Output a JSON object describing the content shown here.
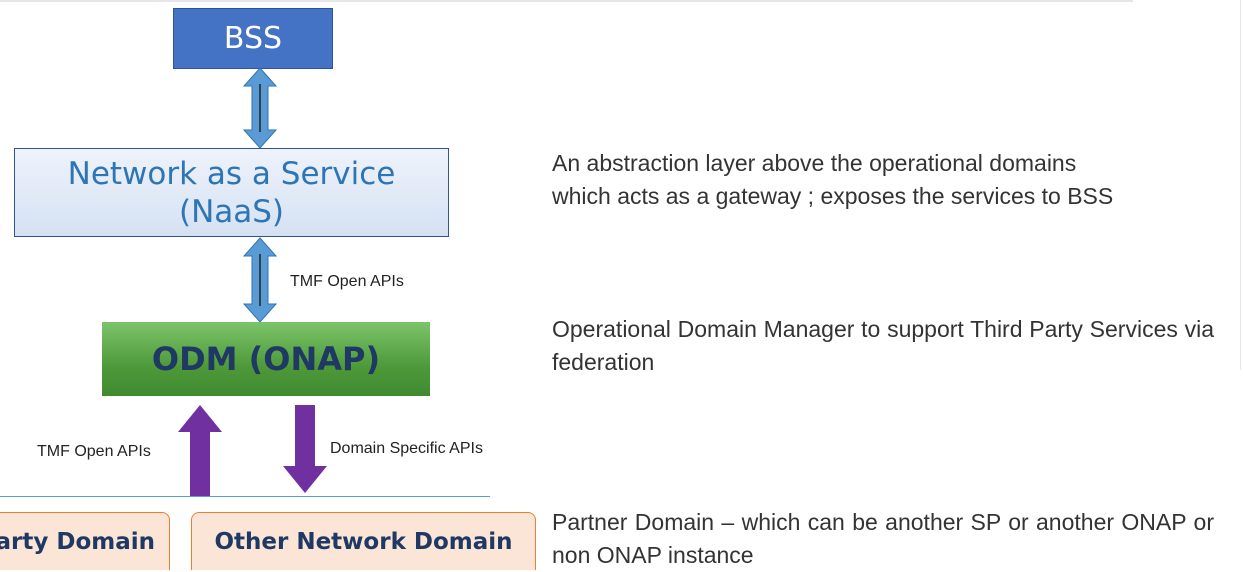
{
  "boxes": {
    "bss": "BSS",
    "naas_line1": "Network as a Service",
    "naas_line2": "(NaaS)",
    "odm": "ODM (ONAP)",
    "third_party_domain": "Third Party Domain",
    "other_network_domain": "Other Network Domain"
  },
  "labels": {
    "tmf_open_apis_top": "TMF Open APIs",
    "tmf_open_apis_bottom": "TMF Open APIs",
    "domain_specific_apis": "Domain Specific APIs"
  },
  "descriptions": {
    "naas_line1": "An abstraction layer above the operational domains",
    "naas_line2": "which acts as a gateway ; exposes the services to BSS",
    "odm": "Operational Domain Manager to support Third Party Services via federation",
    "partner": "Partner Domain – which can be another SP or another ONAP or non ONAP instance"
  },
  "colors": {
    "bss_fill": "#4472c4",
    "naas_text": "#2e75b6",
    "odm_fill": "#5ea84a",
    "domain_fill": "#fbe5d6",
    "domain_border": "#ed7d31",
    "blue_arrow": "#5b9bd5",
    "purple_arrow": "#7030a0"
  }
}
